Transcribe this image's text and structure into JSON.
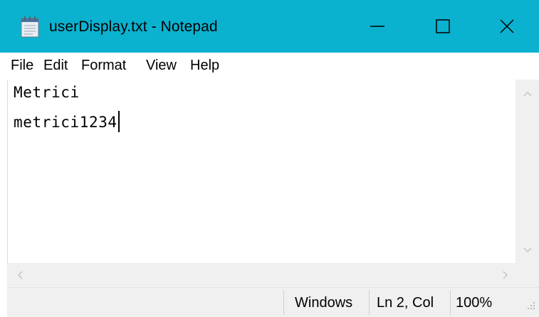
{
  "window": {
    "title": "userDisplay.txt - Notepad",
    "accent_color": "#0ab2cf",
    "icons": {
      "app": "notepad-icon",
      "minimize": "minimize-icon",
      "maximize": "maximize-icon",
      "close": "close-icon"
    }
  },
  "menu": {
    "items": [
      {
        "label": "File"
      },
      {
        "label": "Edit"
      },
      {
        "label": "Format"
      },
      {
        "label": "View"
      },
      {
        "label": "Help"
      }
    ]
  },
  "editor": {
    "lines": [
      "Metrici",
      "metrici1234"
    ]
  },
  "statusbar": {
    "line_ending": "Windows",
    "position": "Ln 2, Col",
    "zoom": "100%"
  }
}
